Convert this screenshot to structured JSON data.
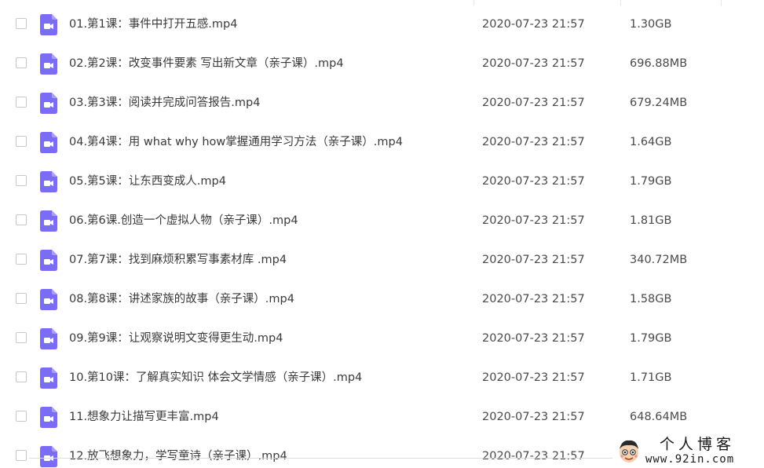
{
  "files": [
    {
      "name": "01.第1课：事件中打开五感.mp4",
      "date": "2020-07-23 21:57",
      "size": "1.30GB",
      "icon": "video-file-icon"
    },
    {
      "name": "02.第2课：改变事件要素 写出新文章（亲子课）.mp4",
      "date": "2020-07-23 21:57",
      "size": "696.88MB",
      "icon": "video-file-icon"
    },
    {
      "name": "03.第3课：阅读并完成问答报告.mp4",
      "date": "2020-07-23 21:57",
      "size": "679.24MB",
      "icon": "video-file-icon"
    },
    {
      "name": "04.第4课：用 what why  how掌握通用学习方法（亲子课）.mp4",
      "date": "2020-07-23 21:57",
      "size": "1.64GB",
      "icon": "video-file-icon"
    },
    {
      "name": "05.第5课：让东西变成人.mp4",
      "date": "2020-07-23 21:57",
      "size": "1.79GB",
      "icon": "video-file-icon"
    },
    {
      "name": "06.第6课.创造一个虚拟人物（亲子课）.mp4",
      "date": "2020-07-23 21:57",
      "size": "1.81GB",
      "icon": "video-file-icon"
    },
    {
      "name": "07.第7课：找到麻烦积累写事素材库 .mp4",
      "date": "2020-07-23 21:57",
      "size": "340.72MB",
      "icon": "video-file-icon"
    },
    {
      "name": "08.第8课：讲述家族的故事（亲子课）.mp4",
      "date": "2020-07-23 21:57",
      "size": "1.58GB",
      "icon": "video-file-icon"
    },
    {
      "name": "09.第9课：让观察说明文变得更生动.mp4",
      "date": "2020-07-23 21:57",
      "size": "1.79GB",
      "icon": "video-file-icon"
    },
    {
      "name": "10.第10课：了解真实知识 体会文学情感（亲子课）.mp4",
      "date": "2020-07-23 21:57",
      "size": "1.71GB",
      "icon": "video-file-icon"
    },
    {
      "name": "11.想象力让描写更丰富.mp4",
      "date": "2020-07-23 21:57",
      "size": "648.64MB",
      "icon": "video-file-icon"
    },
    {
      "name": "12.放飞想象力，学写童诗（亲子课）.mp4",
      "date": "2020-07-23 21:57",
      "size": "",
      "icon": "video-file-icon"
    }
  ],
  "watermark": {
    "title": "个人博客",
    "url": "www.92in.com",
    "avatar_icon": "cartoon-avatar-icon"
  },
  "colors": {
    "icon_purple": "#7b6cf6",
    "text": "#3a3a3a",
    "checkbox_border": "#c8c8c8"
  }
}
